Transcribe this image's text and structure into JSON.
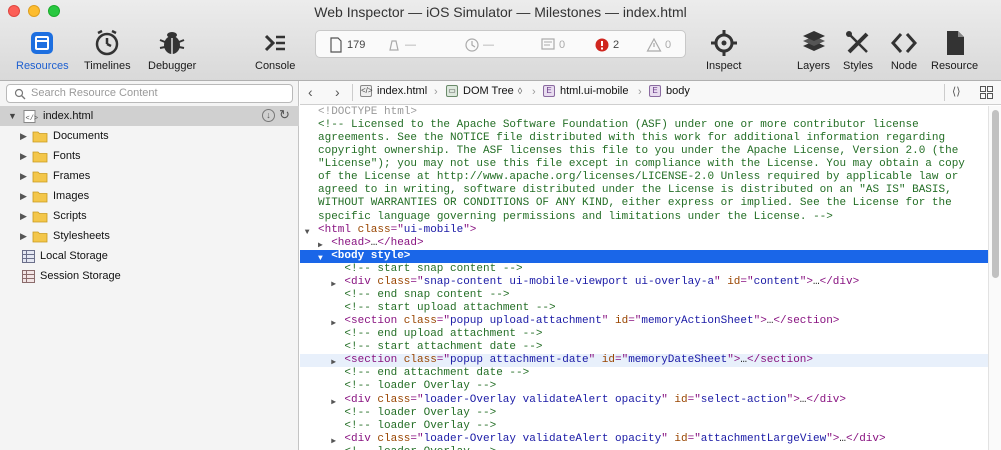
{
  "window": {
    "title": "Web Inspector — iOS Simulator — Milestones — index.html"
  },
  "toolbar": {
    "resources": "Resources",
    "timelines": "Timelines",
    "debugger": "Debugger",
    "console": "Console",
    "inspect": "Inspect",
    "layers": "Layers",
    "styles": "Styles",
    "node": "Node",
    "resource": "Resource"
  },
  "dashboard": {
    "resources_count": "179",
    "resources_size": "—",
    "load_time": "—",
    "logs": "0",
    "errors": "2",
    "warnings": "0",
    "error_color": "#d0261f"
  },
  "sidebar": {
    "search_placeholder": "Search Resource Content",
    "root": "index.html",
    "items": [
      "Documents",
      "Fonts",
      "Frames",
      "Images",
      "Scripts",
      "Stylesheets"
    ],
    "storage": [
      "Local Storage",
      "Session Storage"
    ]
  },
  "navbar": {
    "crumbs": [
      "index.html",
      "DOM Tree",
      "html.ui-mobile",
      "body"
    ],
    "crumb_dropdown": "◊"
  },
  "dom": {
    "doctype": "<!DOCTYPE html>",
    "license": [
      "<!-- Licensed to the Apache Software Foundation (ASF) under one or more contributor license",
      "agreements. See the NOTICE file distributed with this work for additional information regarding",
      "copyright ownership. The ASF licenses this file to you under the Apache License, Version 2.0 (the",
      "\"License\"); you may not use this file except in compliance with the License. You may obtain a copy",
      "of the License at http://www.apache.org/licenses/LICENSE-2.0 Unless required by applicable law or",
      "agreed to in writing, software distributed under the License is distributed on an \"AS IS\" BASIS,",
      "WITHOUT WARRANTIES OR CONDITIONS OF ANY KIND, either express or implied. See the License for the",
      "specific language governing permissions and limitations under the License. -->"
    ],
    "html_open": [
      "<html ",
      "class",
      "=\"",
      "ui-mobile",
      "\">"
    ],
    "head": [
      "<head>",
      "…",
      "</head>"
    ],
    "body": "<body style>",
    "c_start_snap": "<!-- start snap content -->",
    "div_snap": [
      "<div ",
      "class",
      "=\"",
      "snap-content ui-mobile-viewport ui-overlay-a",
      "\" ",
      "id",
      "=\"",
      "content",
      "\">",
      "…",
      "</div>"
    ],
    "c_end_snap": "<!-- end snap content -->",
    "c_start_upload": "<!-- start upload attachment -->",
    "section_upload": [
      "<section ",
      "class",
      "=\"",
      "popup upload-attachment",
      "\" ",
      "id",
      "=\"",
      "memoryActionSheet",
      "\">",
      "…",
      "</section>"
    ],
    "c_end_upload": "<!-- end upload attachment -->",
    "c_start_att": "<!-- start attachment date -->",
    "section_date": [
      "<section ",
      "class",
      "=\"",
      "popup attachment-date",
      "\" ",
      "id",
      "=\"",
      "memoryDateSheet",
      "\">",
      "…",
      "</section>"
    ],
    "c_end_att": "<!-- end attachment date -->",
    "c_loader1": "<!-- loader Overlay -->",
    "div_loader1": [
      "<div ",
      "class",
      "=\"",
      "loader-Overlay validateAlert opacity",
      "\" ",
      "id",
      "=\"",
      "select-action",
      "\">",
      "…",
      "</div>"
    ],
    "c_loader2": "<!-- loader Overlay -->",
    "c_loader3": "<!-- loader Overlay -->",
    "div_loader2": [
      "<div ",
      "class",
      "=\"",
      "loader-Overlay validateAlert opacity",
      "\" ",
      "id",
      "=\"",
      "attachmentLargeView",
      "\">",
      "…",
      "</div>"
    ],
    "c_loader4": "<!-- loader Overlay -->"
  },
  "colors": {
    "selection": "#1a66e8",
    "hover_row": "#e8f0fb",
    "selected_sidebar": "#cfcfcf",
    "folder": "#f3c64a"
  }
}
